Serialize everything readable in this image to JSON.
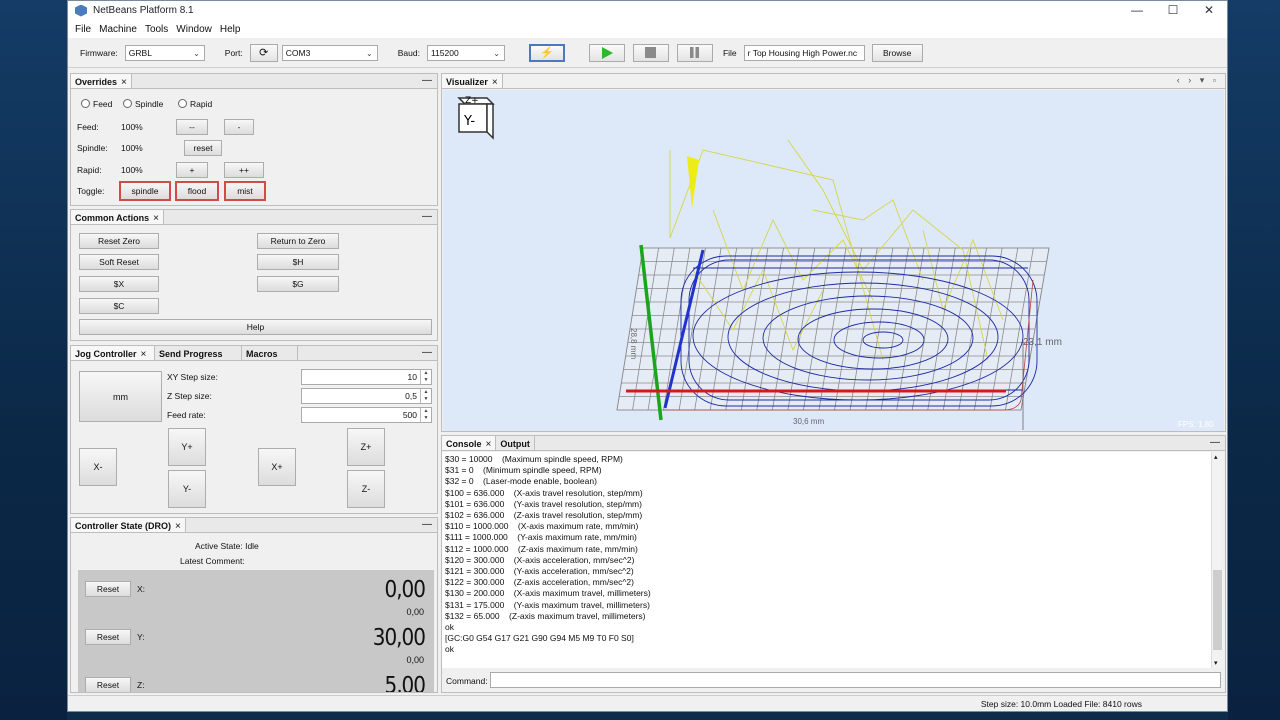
{
  "window": {
    "title": "NetBeans Platform 8.1",
    "controls": [
      "—",
      "☐",
      "✕"
    ]
  },
  "menu": [
    "File",
    "Machine",
    "Tools",
    "Window",
    "Help"
  ],
  "toolbar": {
    "firmware_label": "Firmware:",
    "firmware_value": "GRBL",
    "port_label": "Port:",
    "port_value": "COM3",
    "baud_label": "Baud:",
    "baud_value": "115200",
    "file_label": "File",
    "file_value": "r Top Housing High Power.nc",
    "browse_label": "Browse"
  },
  "overrides": {
    "tab": "Overrides",
    "radios": [
      "Feed",
      "Spindle",
      "Rapid"
    ],
    "rows": [
      {
        "label": "Feed:",
        "value": "100%",
        "btn1": "--",
        "btn2": "-"
      },
      {
        "label": "Spindle:",
        "value": "100%",
        "btn1": "reset"
      },
      {
        "label": "Rapid:",
        "value": "100%",
        "btn1": "+",
        "btn2": "++"
      }
    ],
    "toggle_label": "Toggle:",
    "toggles": [
      "spindle",
      "flood",
      "mist"
    ]
  },
  "common_actions": {
    "tab": "Common Actions",
    "buttons": [
      "Reset Zero",
      "Return to Zero",
      "Soft Reset",
      "$H",
      "$X",
      "$G",
      "$C"
    ],
    "help": "Help"
  },
  "jog": {
    "tabs": [
      "Jog Controller",
      "Send Progress",
      "Macros"
    ],
    "unit": "mm",
    "xy_label": "XY Step size:",
    "xy_value": "10",
    "z_label": "Z Step size:",
    "z_value": "0,5",
    "feed_label": "Feed rate:",
    "feed_value": "500",
    "buttons": {
      "xminus": "X-",
      "xplus": "X+",
      "yplus": "Y+",
      "yminus": "Y-",
      "zplus": "Z+",
      "zminus": "Z-"
    }
  },
  "dro": {
    "tab": "Controller State (DRO)",
    "active_state": "Active State: Idle",
    "latest_comment": "Latest Comment:",
    "reset": "Reset",
    "axes": [
      {
        "label": "X:",
        "work": "0,00",
        "machine": "0,00"
      },
      {
        "label": "Y:",
        "work": "30,00",
        "machine": "0,00"
      },
      {
        "label": "Z:",
        "work": "5,00"
      }
    ]
  },
  "visualizer": {
    "tab": "Visualizer",
    "cube_top": "Z+",
    "cube_front": "Y-",
    "dim_z": "23,1 mm",
    "dim_x": "30,6 mm",
    "dim_y": "28,8 mm",
    "fps": "FPS: 1,80"
  },
  "console": {
    "tabs": [
      "Console",
      "Output"
    ],
    "lines": [
      "$30 = 10000    (Maximum spindle speed, RPM)",
      "$31 = 0    (Minimum spindle speed, RPM)",
      "$32 = 0    (Laser-mode enable, boolean)",
      "$100 = 636.000    (X-axis travel resolution, step/mm)",
      "$101 = 636.000    (Y-axis travel resolution, step/mm)",
      "$102 = 636.000    (Z-axis travel resolution, step/mm)",
      "$110 = 1000.000    (X-axis maximum rate, mm/min)",
      "$111 = 1000.000    (Y-axis maximum rate, mm/min)",
      "$112 = 1000.000    (Z-axis maximum rate, mm/min)",
      "$120 = 300.000    (X-axis acceleration, mm/sec^2)",
      "$121 = 300.000    (Y-axis acceleration, mm/sec^2)",
      "$122 = 300.000    (Z-axis acceleration, mm/sec^2)",
      "$130 = 200.000    (X-axis maximum travel, millimeters)",
      "$131 = 175.000    (Y-axis maximum travel, millimeters)",
      "$132 = 65.000    (Z-axis maximum travel, millimeters)",
      "ok",
      "[GC:G0 G54 G17 G21 G90 G94 M5 M9 T0 F0 S0]",
      "ok"
    ],
    "command_label": "Command:"
  },
  "status": {
    "text": "Step size: 10.0mm Loaded File: 8410 rows"
  },
  "colors": {
    "viz_bg": "#dde8f9",
    "toolpath": "#1c2aa0",
    "rapid": "#e2e23a",
    "x_axis": "#d81818",
    "y_axis": "#1aa51a",
    "z_axis": "#2233cc"
  }
}
